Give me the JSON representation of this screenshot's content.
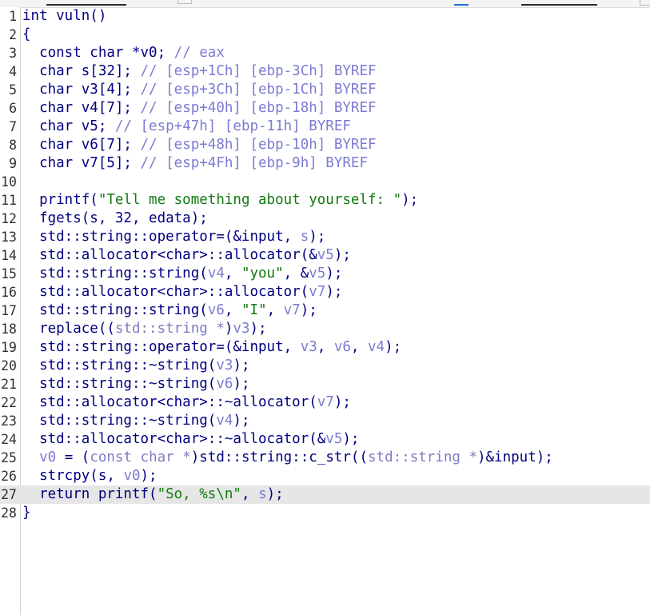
{
  "editor": {
    "current_line": 27,
    "lines": [
      {
        "no": "1",
        "tokens": [
          {
            "t": "int vuln()",
            "c": "plain"
          }
        ]
      },
      {
        "no": "2",
        "tokens": [
          {
            "t": "{",
            "c": "plain"
          }
        ]
      },
      {
        "no": "3",
        "tokens": [
          {
            "t": "  const char *v0; ",
            "c": "plain"
          },
          {
            "t": "// eax",
            "c": "cmt"
          }
        ]
      },
      {
        "no": "4",
        "tokens": [
          {
            "t": "  char s[32]; ",
            "c": "plain"
          },
          {
            "t": "// [esp+1Ch] [ebp-3Ch] BYREF",
            "c": "cmt"
          }
        ]
      },
      {
        "no": "5",
        "tokens": [
          {
            "t": "  char v3[4]; ",
            "c": "plain"
          },
          {
            "t": "// [esp+3Ch] [ebp-1Ch] BYREF",
            "c": "cmt"
          }
        ]
      },
      {
        "no": "6",
        "tokens": [
          {
            "t": "  char v4[7]; ",
            "c": "plain"
          },
          {
            "t": "// [esp+40h] [ebp-18h] BYREF",
            "c": "cmt"
          }
        ]
      },
      {
        "no": "7",
        "tokens": [
          {
            "t": "  char v5; ",
            "c": "plain"
          },
          {
            "t": "// [esp+47h] [ebp-11h] BYREF",
            "c": "cmt"
          }
        ]
      },
      {
        "no": "8",
        "tokens": [
          {
            "t": "  char v6[7]; ",
            "c": "plain"
          },
          {
            "t": "// [esp+48h] [ebp-10h] BYREF",
            "c": "cmt"
          }
        ]
      },
      {
        "no": "9",
        "tokens": [
          {
            "t": "  char v7[5]; ",
            "c": "plain"
          },
          {
            "t": "// [esp+4Fh] [ebp-9h] BYREF",
            "c": "cmt"
          }
        ]
      },
      {
        "no": "10",
        "tokens": []
      },
      {
        "no": "11",
        "tokens": [
          {
            "t": "  printf(",
            "c": "plain"
          },
          {
            "t": "\"Tell me something about yourself: \"",
            "c": "str"
          },
          {
            "t": ");",
            "c": "plain"
          }
        ]
      },
      {
        "no": "12",
        "tokens": [
          {
            "t": "  fgets(s, 32, edata);",
            "c": "plain"
          }
        ]
      },
      {
        "no": "13",
        "tokens": [
          {
            "t": "  std::string::operator=(&input, ",
            "c": "plain"
          },
          {
            "t": "s",
            "c": "var"
          },
          {
            "t": ");",
            "c": "plain"
          }
        ]
      },
      {
        "no": "14",
        "tokens": [
          {
            "t": "  std::allocator<char>::allocator(&",
            "c": "plain"
          },
          {
            "t": "v5",
            "c": "var"
          },
          {
            "t": ");",
            "c": "plain"
          }
        ]
      },
      {
        "no": "15",
        "tokens": [
          {
            "t": "  std::string::string(",
            "c": "plain"
          },
          {
            "t": "v4",
            "c": "var"
          },
          {
            "t": ", ",
            "c": "plain"
          },
          {
            "t": "\"you\"",
            "c": "str"
          },
          {
            "t": ", &",
            "c": "plain"
          },
          {
            "t": "v5",
            "c": "var"
          },
          {
            "t": ");",
            "c": "plain"
          }
        ]
      },
      {
        "no": "16",
        "tokens": [
          {
            "t": "  std::allocator<char>::allocator(",
            "c": "plain"
          },
          {
            "t": "v7",
            "c": "var"
          },
          {
            "t": ");",
            "c": "plain"
          }
        ]
      },
      {
        "no": "17",
        "tokens": [
          {
            "t": "  std::string::string(",
            "c": "plain"
          },
          {
            "t": "v6",
            "c": "var"
          },
          {
            "t": ", ",
            "c": "plain"
          },
          {
            "t": "\"I\"",
            "c": "str"
          },
          {
            "t": ", ",
            "c": "plain"
          },
          {
            "t": "v7",
            "c": "var"
          },
          {
            "t": ");",
            "c": "plain"
          }
        ]
      },
      {
        "no": "18",
        "tokens": [
          {
            "t": "  replace((",
            "c": "plain"
          },
          {
            "t": "std::string *",
            "c": "type"
          },
          {
            "t": ")",
            "c": "plain"
          },
          {
            "t": "v3",
            "c": "var"
          },
          {
            "t": ");",
            "c": "plain"
          }
        ]
      },
      {
        "no": "19",
        "tokens": [
          {
            "t": "  std::string::operator=(&input, ",
            "c": "plain"
          },
          {
            "t": "v3",
            "c": "var"
          },
          {
            "t": ", ",
            "c": "plain"
          },
          {
            "t": "v6",
            "c": "var"
          },
          {
            "t": ", ",
            "c": "plain"
          },
          {
            "t": "v4",
            "c": "var"
          },
          {
            "t": ");",
            "c": "plain"
          }
        ]
      },
      {
        "no": "20",
        "tokens": [
          {
            "t": "  std::string::~string(",
            "c": "plain"
          },
          {
            "t": "v3",
            "c": "var"
          },
          {
            "t": ");",
            "c": "plain"
          }
        ]
      },
      {
        "no": "21",
        "tokens": [
          {
            "t": "  std::string::~string(",
            "c": "plain"
          },
          {
            "t": "v6",
            "c": "var"
          },
          {
            "t": ");",
            "c": "plain"
          }
        ]
      },
      {
        "no": "22",
        "tokens": [
          {
            "t": "  std::allocator<char>::~allocator(",
            "c": "plain"
          },
          {
            "t": "v7",
            "c": "var"
          },
          {
            "t": ");",
            "c": "plain"
          }
        ]
      },
      {
        "no": "23",
        "tokens": [
          {
            "t": "  std::string::~string(",
            "c": "plain"
          },
          {
            "t": "v4",
            "c": "var"
          },
          {
            "t": ");",
            "c": "plain"
          }
        ]
      },
      {
        "no": "24",
        "tokens": [
          {
            "t": "  std::allocator<char>::~allocator(&",
            "c": "plain"
          },
          {
            "t": "v5",
            "c": "var"
          },
          {
            "t": ");",
            "c": "plain"
          }
        ]
      },
      {
        "no": "25",
        "tokens": [
          {
            "t": "  ",
            "c": "plain"
          },
          {
            "t": "v0",
            "c": "var"
          },
          {
            "t": " = (",
            "c": "plain"
          },
          {
            "t": "const char *",
            "c": "type"
          },
          {
            "t": ")std::string::c_str((",
            "c": "plain"
          },
          {
            "t": "std::string *",
            "c": "type"
          },
          {
            "t": ")&input);",
            "c": "plain"
          }
        ]
      },
      {
        "no": "26",
        "tokens": [
          {
            "t": "  strcpy(s, ",
            "c": "plain"
          },
          {
            "t": "v0",
            "c": "var"
          },
          {
            "t": ");",
            "c": "plain"
          }
        ]
      },
      {
        "no": "27",
        "tokens": [
          {
            "t": "  return printf(",
            "c": "plain"
          },
          {
            "t": "\"So, %s\\n\"",
            "c": "str"
          },
          {
            "t": ", ",
            "c": "plain"
          },
          {
            "t": "s",
            "c": "var"
          },
          {
            "t": ");",
            "c": "plain"
          }
        ]
      },
      {
        "no": "28",
        "tokens": [
          {
            "t": "}",
            "c": "plain"
          }
        ]
      }
    ]
  }
}
